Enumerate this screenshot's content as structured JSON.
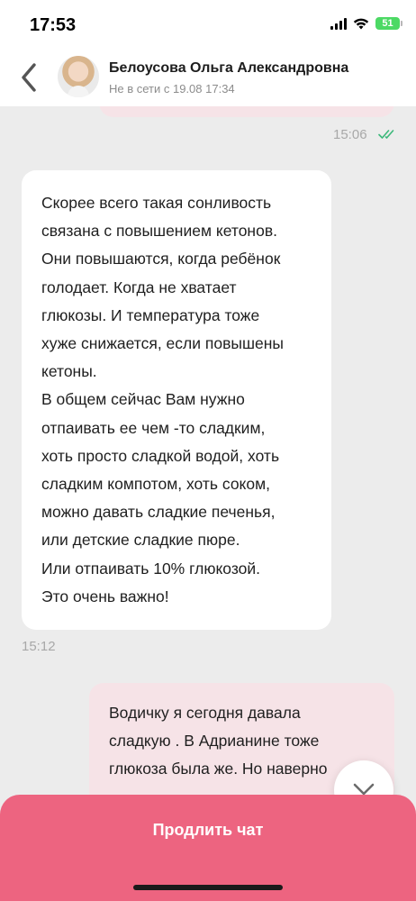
{
  "status_bar": {
    "time": "17:53",
    "battery": "51"
  },
  "header": {
    "back_icon": "chevron-left-icon",
    "contact_name": "Белоусова Ольга Александровна",
    "contact_status": "Не в сети с 19.08 17:34"
  },
  "messages": {
    "outgoing_top_time": "15:06",
    "incoming": {
      "lines": [
        "Скорее всего такая сонливость",
        "связана с повышением кетонов.",
        "Они повышаются, когда ребёнок",
        "голодает. Когда не хватает",
        "глюкозы. И температура тоже",
        "хуже снижается, если повышены",
        "кетоны.",
        "В общем сейчас Вам нужно",
        "отпаивать ее чем -то сладким,",
        "хоть просто сладкой водой, хоть",
        "сладким компотом, хоть соком,",
        "можно давать сладкие печенья,",
        "или детские сладкие пюре.",
        "Или отпаивать 10% глюкозой.",
        "Это очень важно!"
      ],
      "time": "15:12"
    },
    "outgoing_bottom": {
      "lines": [
        "Водичку я сегодня давала",
        "сладкую . В Адрианине тоже",
        "глюкоза была же. Но наверно"
      ]
    }
  },
  "bottom_panel": {
    "extend_chat_label": "Продлить чат"
  },
  "colors": {
    "accent": "#ed6480",
    "outgoing_bubble": "#f6e3e7",
    "incoming_bubble": "#ffffff",
    "background": "#ececec",
    "read_check": "#3cb87a"
  }
}
